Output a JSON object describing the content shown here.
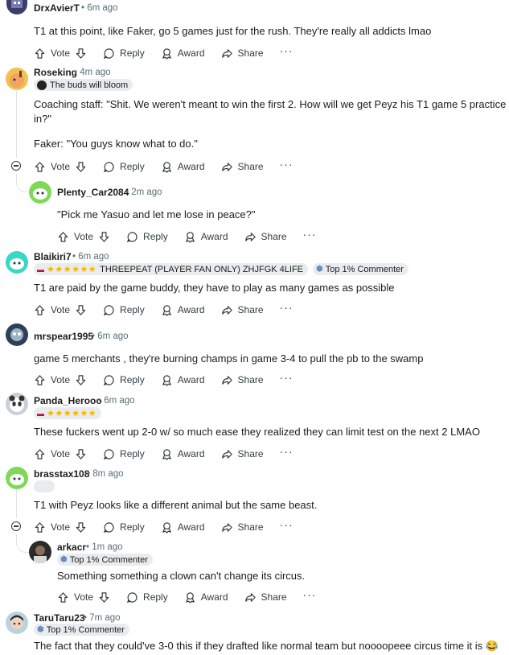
{
  "actions": {
    "vote": "Vote",
    "reply": "Reply",
    "award": "Award",
    "share": "Share",
    "more": "···"
  },
  "comments": [
    {
      "user": "DrxAvierT",
      "time": "• 6m ago",
      "body": [
        "T1 at this point, like Faker, go 5 games just for the rush. They're really all addicts lmao"
      ]
    },
    {
      "user": "Roseking",
      "time": "• 4m ago",
      "flair": "The buds will bloom",
      "body": [
        "Coaching staff: \"Shit. We weren't meant to win the first 2. How will we get Peyz his T1 game 5 practice",
        "in?\"",
        "Faker: \"You guys know what to do.\""
      ]
    },
    {
      "user": "Plenty_Car2084",
      "time": "• 2m ago",
      "body": [
        "\"Pick me Yasuo and let me lose in peace?\""
      ]
    },
    {
      "user": "Blaikiri7",
      "time": "• 6m ago",
      "flair": "THREEPEAT (PLAYER FAN ONLY) ZHJFGK 4LIFE",
      "badge": "Top 1% Commenter",
      "body": [
        "T1 are paid by the game buddy, they have to play as many games as possible"
      ]
    },
    {
      "user": "mrspear1995",
      "time": "• 6m ago",
      "body": [
        "game 5 merchants , they're burning champs in game 3-4 to pull the pb to the swamp"
      ]
    },
    {
      "user": "Panda_Herooo",
      "time": "• 6m ago",
      "body": [
        "These fuckers went up 2-0 w/ so much ease they realized they can limit test on the next 2 LMAO"
      ]
    },
    {
      "user": "brasstax108",
      "time": "• 8m ago",
      "body": [
        "T1 with Peyz looks like a different animal but the same beast."
      ]
    },
    {
      "user": "arkacr",
      "time": "• 1m ago",
      "badge": "Top 1% Commenter",
      "body": [
        "Something something a clown can't change its circus."
      ]
    },
    {
      "user": "TaruTaru23",
      "time": "• 7m ago",
      "badge": "Top 1% Commenter",
      "body": [
        "The fact that they could've 3-0 this if they drafted like normal team but noooopeee circus time it is 😂"
      ]
    }
  ],
  "colors": {
    "meta": "#576f76",
    "action": "#333d42",
    "flair_bg": "#e8ecee",
    "t1_red": "#c8102e",
    "star": "#f6b400"
  }
}
